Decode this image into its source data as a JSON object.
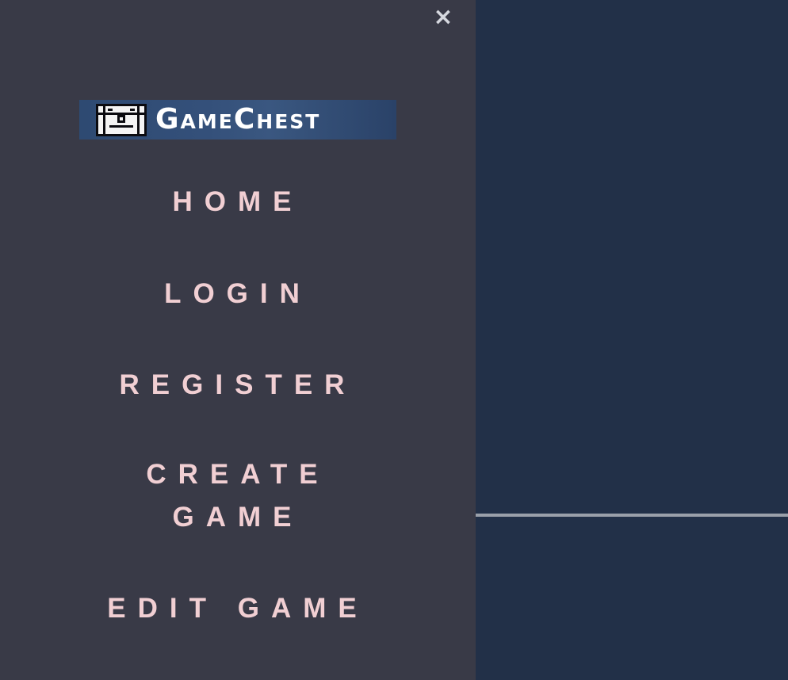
{
  "sidebar": {
    "close_label": "×",
    "logo": {
      "text": "GameChest",
      "icon": "treasure-chest-icon"
    },
    "nav": {
      "home": "HOME",
      "login": "LOGIN",
      "register": "REGISTER",
      "create_game": [
        "CREATE",
        "GAME"
      ],
      "edit_game": "EDIT GAME"
    }
  },
  "colors": {
    "sidebar_bg": "#393a47",
    "main_bg": "#223048",
    "nav_text": "#f1cfd3",
    "logo_bg": "#34507a"
  }
}
